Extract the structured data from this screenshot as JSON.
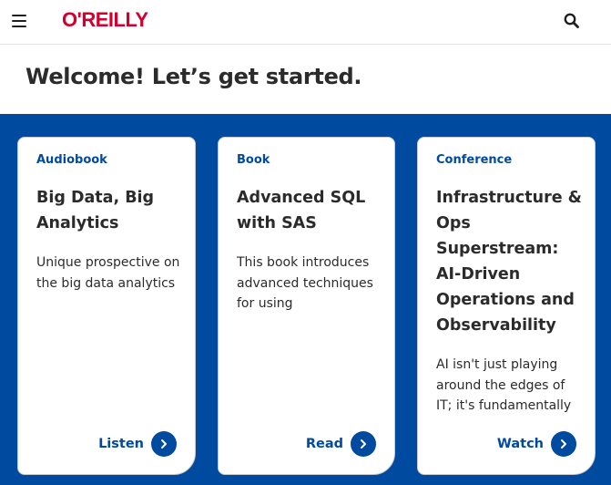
{
  "header": {
    "logo_text": "O'REILLY",
    "logo_color": "#d3002d",
    "menu_icon": "hamburger-menu-icon",
    "search_icon": "search-icon"
  },
  "welcome_text": "Welcome! Let’s get started.",
  "band_color": "#004a9f",
  "cards": [
    {
      "type": "Audiobook",
      "title": "Big Data, Big Analytics",
      "description": "Unique prospective on the big data analytics",
      "action_label": "Listen"
    },
    {
      "type": "Book",
      "title": "Advanced SQL with SAS",
      "description": "This book introduces advanced techniques for using",
      "action_label": "Read"
    },
    {
      "type": "Conference",
      "title": "Infrastructure & Ops Superstream: AI-Driven Operations and Observability",
      "description": "AI isn't just playing around the edges of IT; it's fundamentally",
      "action_label": "Watch"
    }
  ]
}
